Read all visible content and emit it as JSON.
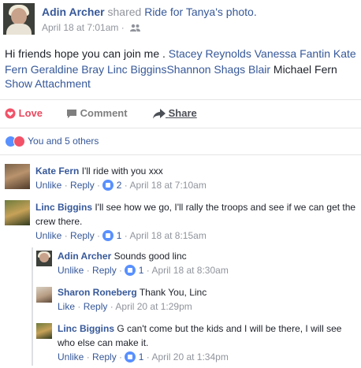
{
  "post": {
    "author": "Adin Archer",
    "shared_text": "shared",
    "target_name": "Ride for Tanya",
    "target_suffix": "'s photo.",
    "timestamp": "April 18 at 7:01am",
    "separator": "·",
    "audience_icon": "friends-icon",
    "text_prefix": "Hi friends hope you can join me . ",
    "tags": [
      "Stacey Reynolds",
      "Vanessa Fantin",
      "Kate Fern",
      "Geraldine Bray",
      "Linc Biggins",
      "Shannon Shags Blair"
    ],
    "text_suffix": "Michael Fern",
    "attachment_link": "Show Attachment"
  },
  "actions": {
    "love": "Love",
    "comment": "Comment",
    "share": "Share"
  },
  "reactions": {
    "summary": "You and 5 others",
    "colors": {
      "like": "#5890ff",
      "love": "#f25268"
    }
  },
  "comments": [
    {
      "name": "Kate Fern",
      "text": "I'll ride with you xxx",
      "unlike": "Unlike",
      "reply": "Reply",
      "likes": "2",
      "time": "April 18 at 7:10am"
    },
    {
      "name": "Linc Biggins",
      "text": "I'll see how we go, I'll rally the troops and see if we can get the crew there.",
      "unlike": "Unlike",
      "reply": "Reply",
      "likes": "1",
      "time": "April 18 at 8:15am"
    }
  ],
  "replies": [
    {
      "name": "Adin Archer",
      "text": "Sounds good linc",
      "action": "Unlike",
      "reply": "Reply",
      "likes": "1",
      "time": "April 18 at 8:30am"
    },
    {
      "name": "Sharon Roneberg",
      "text": "Thank You, Linc",
      "action": "Like",
      "reply": "Reply",
      "likes": "",
      "time": "April 20 at 1:29pm"
    },
    {
      "name": "Linc Biggins",
      "text": "G can't come but the kids and I will be there, I will see who else can make it.",
      "action": "Unlike",
      "reply": "Reply",
      "likes": "1",
      "time": "April 20 at 1:34pm"
    }
  ],
  "link_separator": " · "
}
